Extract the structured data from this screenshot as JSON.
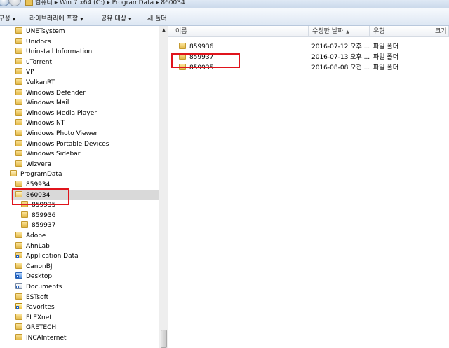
{
  "address": {
    "breadcrumb": [
      "컴퓨터",
      "Win 7 x64 (C:)",
      "ProgramData",
      "860034"
    ]
  },
  "toolbar": {
    "organize": "구성",
    "include_library": "라이브러리에 포함",
    "share_with": "공유 대상",
    "new_folder": "새 폴더"
  },
  "tree": {
    "items": [
      {
        "label": "UNETsystem",
        "depth": 1,
        "icon": "folder-icon"
      },
      {
        "label": "Unidocs",
        "depth": 1,
        "icon": "folder-icon"
      },
      {
        "label": "Uninstall Information",
        "depth": 1,
        "icon": "folder-icon"
      },
      {
        "label": "uTorrent",
        "depth": 1,
        "icon": "folder-icon"
      },
      {
        "label": "VP",
        "depth": 1,
        "icon": "folder-icon"
      },
      {
        "label": "VulkanRT",
        "depth": 1,
        "icon": "folder-icon"
      },
      {
        "label": "Windows Defender",
        "depth": 1,
        "icon": "folder-icon"
      },
      {
        "label": "Windows Mail",
        "depth": 1,
        "icon": "folder-icon"
      },
      {
        "label": "Windows Media Player",
        "depth": 1,
        "icon": "folder-icon"
      },
      {
        "label": "Windows NT",
        "depth": 1,
        "icon": "folder-icon"
      },
      {
        "label": "Windows Photo Viewer",
        "depth": 1,
        "icon": "folder-icon"
      },
      {
        "label": "Windows Portable Devices",
        "depth": 1,
        "icon": "folder-icon"
      },
      {
        "label": "Windows Sidebar",
        "depth": 1,
        "icon": "folder-icon"
      },
      {
        "label": "Wizvera",
        "depth": 1,
        "icon": "folder-icon"
      },
      {
        "label": "ProgramData",
        "depth": 0,
        "icon": "folder-open-icon"
      },
      {
        "label": "859934",
        "depth": 1,
        "icon": "folder-icon"
      },
      {
        "label": "860034",
        "depth": 1,
        "icon": "folder-open-icon",
        "selected": true
      },
      {
        "label": "859935",
        "depth": 2,
        "icon": "folder-icon"
      },
      {
        "label": "859936",
        "depth": 2,
        "icon": "folder-icon"
      },
      {
        "label": "859937",
        "depth": 2,
        "icon": "folder-icon"
      },
      {
        "label": "Adobe",
        "depth": 1,
        "icon": "folder-icon"
      },
      {
        "label": "AhnLab",
        "depth": 1,
        "icon": "folder-icon"
      },
      {
        "label": "Application Data",
        "depth": 1,
        "icon": "folder-shortcut-icon"
      },
      {
        "label": "CanonBJ",
        "depth": 1,
        "icon": "folder-icon"
      },
      {
        "label": "Desktop",
        "depth": 1,
        "icon": "desktop-shortcut-icon"
      },
      {
        "label": "Documents",
        "depth": 1,
        "icon": "documents-shortcut-icon"
      },
      {
        "label": "ESTsoft",
        "depth": 1,
        "icon": "folder-icon"
      },
      {
        "label": "Favorites",
        "depth": 1,
        "icon": "favorites-shortcut-icon"
      },
      {
        "label": "FLEXnet",
        "depth": 1,
        "icon": "folder-icon"
      },
      {
        "label": "GRETECH",
        "depth": 1,
        "icon": "folder-icon"
      },
      {
        "label": "INCAInternet",
        "depth": 1,
        "icon": "folder-icon"
      }
    ]
  },
  "columns": {
    "name": "이름",
    "modified": "수정한 날짜",
    "type": "유형",
    "size": "크기"
  },
  "files": [
    {
      "name": "859936",
      "modified": "2016-07-12 오후 ...",
      "type": "파일 폴더"
    },
    {
      "name": "859937",
      "modified": "2016-07-13 오후 ...",
      "type": "파일 폴더"
    },
    {
      "name": "859935",
      "modified": "2016-08-08 오전 ...",
      "type": "파일 폴더"
    }
  ],
  "colors": {
    "highlight_box": "#e0141c",
    "selection": "#d9d9d9"
  }
}
